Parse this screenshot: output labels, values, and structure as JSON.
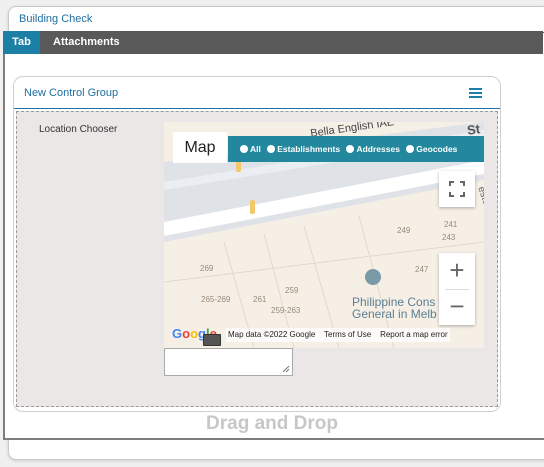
{
  "window": {
    "title": "Building Check"
  },
  "tabs": [
    {
      "label": "Tab",
      "active": true
    },
    {
      "label": "Attachments",
      "active": false
    }
  ],
  "group": {
    "title": "New Control Group",
    "menu_icon": "hamburger-menu-icon"
  },
  "field": {
    "label": "Location Chooser"
  },
  "map": {
    "type_button": "Map",
    "filter_options": [
      "All",
      "Establishments",
      "Addresses",
      "Geocodes"
    ],
    "street_labels": [
      "Bella English IAE",
      "St",
      "ester"
    ],
    "numbers": [
      "249",
      "241",
      "243",
      "247",
      "269",
      "265-269",
      "261",
      "259",
      "259-263"
    ],
    "place": {
      "line1": "Philippine Cons",
      "line2": "General in Melb"
    },
    "logo": "Google",
    "attribution": {
      "data": "Map data ©2022 Google",
      "terms": "Terms of Use",
      "report": "Report a map error"
    },
    "icons": {
      "fullscreen": "fullscreen-icon",
      "zoom_in": "plus-icon",
      "zoom_out": "minus-icon",
      "keyboard": "keyboard-icon",
      "place": "embassy-pin-icon"
    }
  },
  "dropzone": {
    "text": "Drag and Drop"
  },
  "colors": {
    "accent": "#1c7fa6",
    "tabbar": "#595959",
    "map_options": "#23889e",
    "title_text": "#1f6fa0"
  }
}
